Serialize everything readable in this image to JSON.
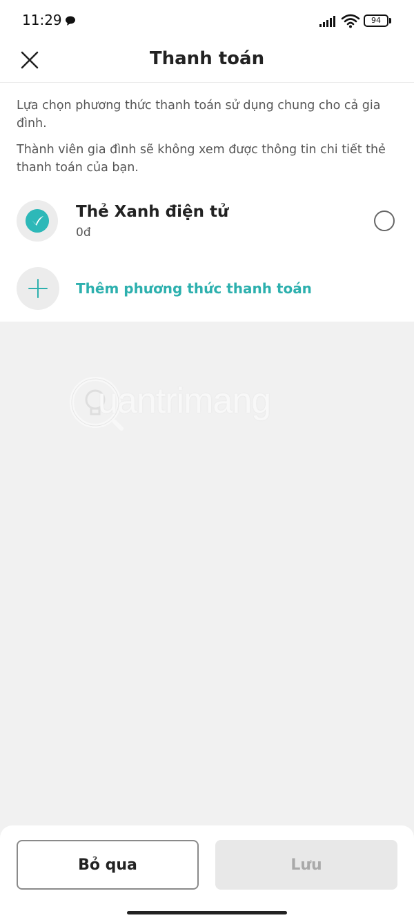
{
  "status_bar": {
    "time": "11:29",
    "battery": "94",
    "icons": [
      "message-icon",
      "signal-icon",
      "wifi-icon",
      "battery-icon"
    ]
  },
  "header": {
    "title": "Thanh toán",
    "close_icon": "close-icon"
  },
  "description": {
    "line1": "Lựa chọn phương thức thanh toán sử dụng chung cho cả gia đình.",
    "line2": "Thành viên gia đình sẽ không xem được thông tin chi tiết thẻ thanh toán của bạn."
  },
  "payment_methods": [
    {
      "name": "Thẻ Xanh điện tử",
      "balance": "0đ",
      "icon": "green-card-icon",
      "selected": false
    }
  ],
  "add_method": {
    "label": "Thêm phương thức thanh toán",
    "icon": "plus-icon"
  },
  "watermark": {
    "text": "uantrimang"
  },
  "footer": {
    "skip_label": "Bỏ qua",
    "save_label": "Lưu"
  },
  "colors": {
    "accent": "#2db8b8",
    "background": "#f1f1f1",
    "disabled": "#e8e8e8"
  }
}
